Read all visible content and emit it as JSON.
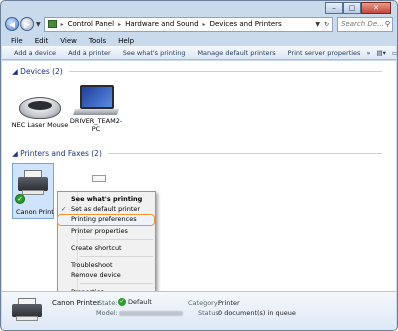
{
  "window": {
    "caption_minimize": "–",
    "caption_maximize": "□",
    "caption_close": "✕"
  },
  "address": {
    "crumbs": [
      "Control Panel",
      "Hardware and Sound",
      "Devices and Printers"
    ],
    "search_placeholder": "Search De..."
  },
  "menubar": [
    "File",
    "Edit",
    "View",
    "Tools",
    "Help"
  ],
  "commandbar": {
    "items": [
      "Add a device",
      "Add a printer",
      "See what's printing",
      "Manage default printers",
      "Print server properties"
    ],
    "overflow": "»"
  },
  "groups": {
    "devices": "Devices (2)",
    "printers": "Printers and Faxes (2)"
  },
  "devices": [
    {
      "label": "NEC Laser Mouse"
    },
    {
      "label": "DRIVER_TEAM2-PC"
    }
  ],
  "printers": [
    {
      "label": "Canon Print"
    }
  ],
  "context_menu": {
    "items": [
      {
        "label": "See what's printing",
        "bold": true
      },
      {
        "label": "Set as default printer",
        "checked": true
      },
      {
        "label": "Printing preferences",
        "highlighted": true
      },
      {
        "label": "Printer properties"
      },
      {
        "label": "Create shortcut"
      },
      {
        "label": "Troubleshoot"
      },
      {
        "label": "Remove device"
      },
      {
        "label": "Properties"
      }
    ]
  },
  "details": {
    "name": "Canon Printer",
    "state_label": "State:",
    "state_value": "Default",
    "model_label": "Model:",
    "category_label": "Category:",
    "category_value": "Printer",
    "status_label": "Status:",
    "status_value": "0 document(s) in queue"
  },
  "colors": {
    "chrome": "#c9daed",
    "highlight_border": "#f0962e",
    "group_header": "#1e3287"
  }
}
